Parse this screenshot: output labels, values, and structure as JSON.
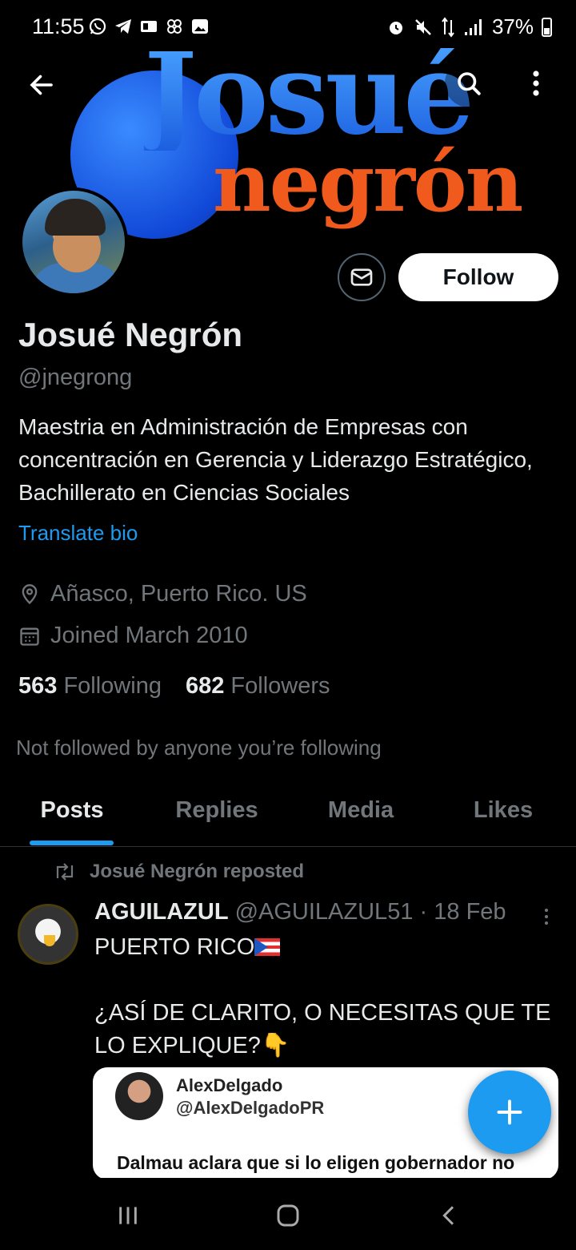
{
  "status_bar": {
    "time": "11:55",
    "battery": "37%"
  },
  "banner": {
    "line1": "Josué",
    "line2": "negrón",
    "bigletter": "J"
  },
  "profile": {
    "display_name": "Josué Negrón",
    "handle": "@jnegrong",
    "bio": "Maestria en Administración de Empresas con concentración en Gerencia y Liderazgo Estratégico, Bachillerato en Ciencias Sociales",
    "translate_label": "Translate bio",
    "location": "Añasco, Puerto Rico. US",
    "joined": "Joined March 2010",
    "following_count": "563",
    "following_label": "Following",
    "followers_count": "682",
    "followers_label": "Followers",
    "not_followed_text": "Not followed by anyone you’re following",
    "follow_label": "Follow"
  },
  "tabs": [
    {
      "label": "Posts",
      "active": true
    },
    {
      "label": "Replies",
      "active": false
    },
    {
      "label": "Media",
      "active": false
    },
    {
      "label": "Likes",
      "active": false
    }
  ],
  "tweet": {
    "repost_label": "Josué Negrón reposted",
    "author_name": "AGUILAZUL",
    "author_handle": "@AGUILAZUL51",
    "separator": "·",
    "date": "18 Feb",
    "text_line1": "PUERTO RICO",
    "text_line2": "¿ASÍ DE CLARITO, O NECESITAS QUE TE LO EXPLIQUE?",
    "emoji_flag": "puerto-rico-flag",
    "emoji_point": "👇",
    "card": {
      "name": "AlexDelgado",
      "handle": "@AlexDelgadoPR",
      "text": "Dalmau aclara que si lo eligen gobernador no"
    }
  },
  "icons": {
    "back": "arrow-left-icon",
    "search": "search-icon",
    "more": "more-vertical-icon",
    "message": "envelope-icon",
    "location": "location-pin-icon",
    "calendar": "calendar-icon",
    "repost": "repost-icon",
    "compose": "plus-icon"
  },
  "colors": {
    "background": "#000000",
    "accent": "#1d9bf0",
    "secondary_text": "#71767b",
    "primary_text": "#e7e9ea",
    "banner_blue": "#1f78f0",
    "banner_orange": "#f05a1c"
  }
}
